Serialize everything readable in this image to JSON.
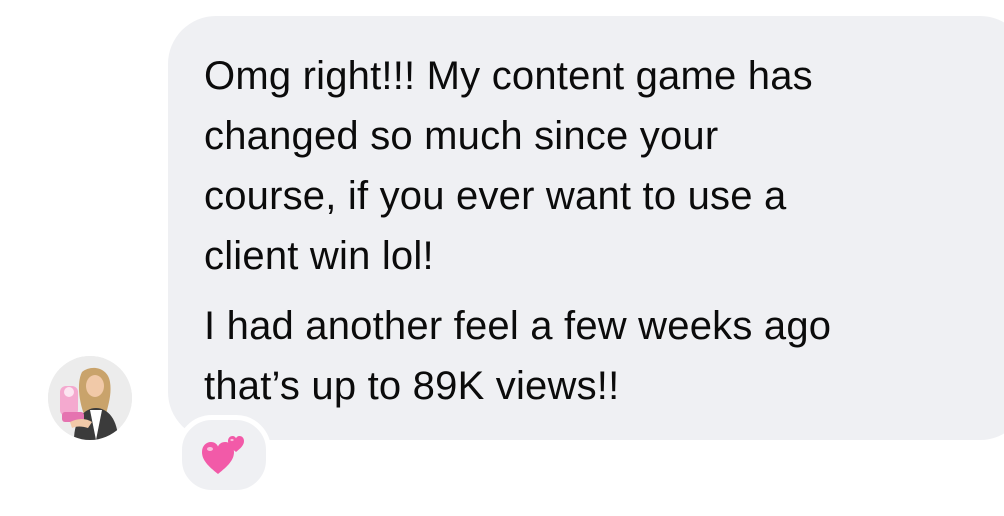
{
  "message": {
    "lines_p1": [
      "Omg right!!! My content game has",
      "changed so much since your",
      "course, if you ever want to use a",
      "client win lol!"
    ],
    "lines_p2": [
      "I had another feel a few weeks ago",
      "that’s up to 89K views!!"
    ]
  },
  "reaction": {
    "icon": "two-hearts-icon"
  },
  "avatar": {
    "icon": "profile-photo"
  },
  "colors": {
    "bubble": "#eff0f3",
    "text": "#0b0b0b",
    "heart": "#f25aa8"
  }
}
